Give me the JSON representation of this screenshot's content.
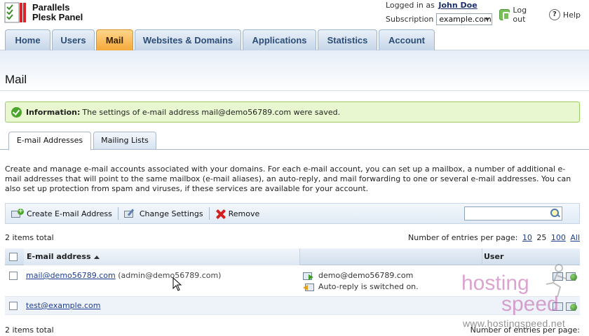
{
  "brand": {
    "line1": "Parallels",
    "line2": "Plesk Panel"
  },
  "header": {
    "logged_in_label": "Logged in as",
    "user_name": "John Doe",
    "subscription_label": "Subscription",
    "subscription_value": "example.com",
    "logout_label": "Log out",
    "help_label": "Help"
  },
  "nav": {
    "tabs": [
      {
        "label": "Home"
      },
      {
        "label": "Users"
      },
      {
        "label": "Mail",
        "active": true
      },
      {
        "label": "Websites & Domains"
      },
      {
        "label": "Applications"
      },
      {
        "label": "Statistics"
      },
      {
        "label": "Account"
      }
    ]
  },
  "page": {
    "title": "Mail",
    "info_label": "Information:",
    "info_text": "The settings of e-mail address mail@demo56789.com were saved.",
    "subtabs": [
      {
        "label": "E-mail Addresses",
        "active": true
      },
      {
        "label": "Mailing Lists"
      }
    ],
    "description": "Create and manage e-mail accounts associated with your domains. For each e-mail account, you can set up a mailbox, a number of additional e-mail addresses that will point to the same mailbox (e-mail aliases), an auto-reply, and mail forwarding to one or several e-mail addresses. You can also set up protection from spam and viruses, if these services are available for your account."
  },
  "toolbar": {
    "create_label": "Create E-mail Address",
    "settings_label": "Change Settings",
    "remove_label": "Remove",
    "search_value": ""
  },
  "list": {
    "items_total": "2 items total",
    "per_page_label": "Number of entries per page:",
    "per_page_options": [
      "10",
      "25",
      "100",
      "All"
    ],
    "per_page_current": "25",
    "columns": {
      "email": "E-mail address",
      "user": "User"
    },
    "rows": [
      {
        "email": "mail@demo56789.com",
        "alias": "(admin@demo56789.com)",
        "forward": "demo@demo56789.com",
        "autoreply": "Auto-reply is switched on."
      },
      {
        "email": "test@example.com"
      }
    ]
  },
  "watermark": {
    "word1": "hosting",
    "word2": "speed",
    "url": "www.hostingspeed.net"
  },
  "colors": {
    "active_tab": "#f4a83a",
    "nav_tab": "#c6d6e8",
    "info_bg": "#e8f7cf",
    "link": "#1e3d8f"
  }
}
